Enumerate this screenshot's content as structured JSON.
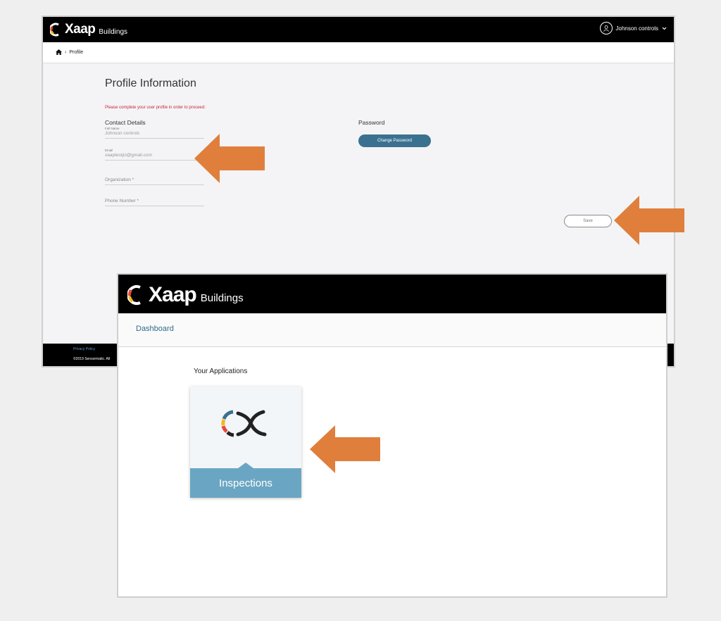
{
  "brand": {
    "word": "Xaap",
    "sub": "Buildings"
  },
  "profile_window": {
    "user_menu": {
      "name": "Johnson controls"
    },
    "breadcrumb": {
      "current": "Profile"
    },
    "title": "Profile Information",
    "warning": "Please complete your user profile in order to proceed:",
    "contact_section": "Contact Details",
    "fields": {
      "full_name": {
        "label": "Full Name",
        "value": "Johnson controls"
      },
      "email": {
        "label": "Email",
        "value": "xaaptestjci@gmail.com"
      },
      "organization": {
        "placeholder": "Organization *"
      },
      "phone": {
        "placeholder": "Phone Number *"
      }
    },
    "password_section": "Password",
    "change_password_label": "Change Password",
    "save_label": "Save",
    "footer": {
      "privacy": "Privacy Policy",
      "copyright": "©2019 Sensormatic. All"
    }
  },
  "dashboard_window": {
    "nav_label": "Dashboard",
    "apps_heading": "Your Applications",
    "apps": [
      {
        "label": "Inspections"
      }
    ]
  },
  "colors": {
    "arrow": "#e07f3c",
    "primary_button": "#3b7190",
    "warning": "#c8263a",
    "app_band": "#6aa6c3"
  }
}
